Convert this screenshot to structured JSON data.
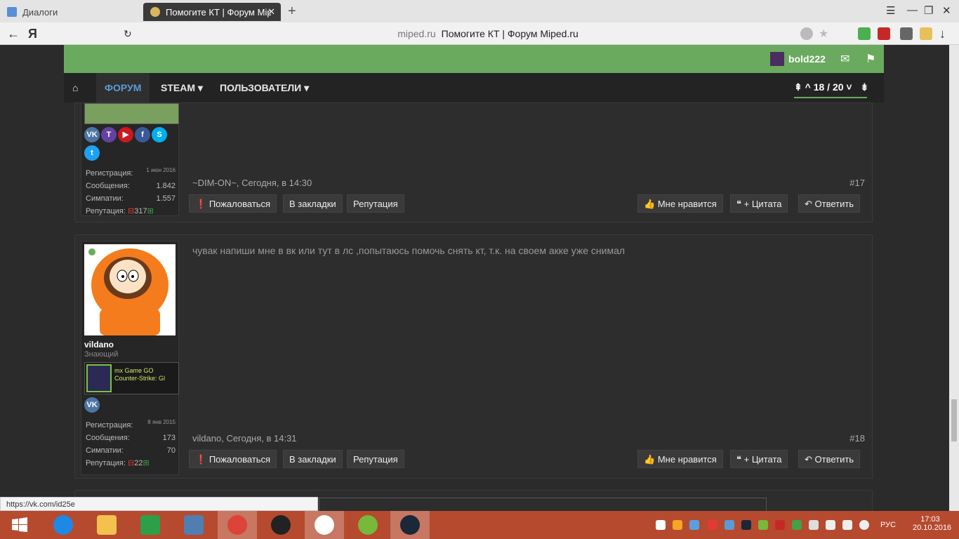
{
  "browser": {
    "tabs": [
      {
        "label": "Диалоги"
      },
      {
        "label": "Помогите КТ | Форум Miped.ru"
      }
    ],
    "address": {
      "domain": "miped.ru",
      "title": "Помогите КТ | Форум Miped.ru"
    },
    "status_url": "https://vk.com/id25e"
  },
  "site": {
    "username": "bold222",
    "nav": {
      "home_icon": "home-icon",
      "forum": "ФОРУМ",
      "steam": "STEAM",
      "users": "ПОЛЬЗОВАТЕЛИ"
    },
    "pager": "18 / 20"
  },
  "posts": [
    {
      "author": "~DIM-ON~",
      "time": "Сегодня, в 14:30",
      "number": "#17",
      "stats": {
        "reg_label": "Регистрация:",
        "reg": "1 июн 2016",
        "msg_label": "Сообщения:",
        "messages": "1.842",
        "likes_label": "Симпатии:",
        "likes": "1.557",
        "rep_label": "Репутация:",
        "reputation": "317"
      },
      "social": [
        {
          "name": "vk",
          "label": "VK",
          "color": "#4c75a3"
        },
        {
          "name": "twitch",
          "label": "T",
          "color": "#6441a5"
        },
        {
          "name": "youtube",
          "label": "▶",
          "color": "#cc181e"
        },
        {
          "name": "facebook",
          "label": "f",
          "color": "#3b5998"
        },
        {
          "name": "skype",
          "label": "S",
          "color": "#00aff0"
        },
        {
          "name": "twitter",
          "label": "t",
          "color": "#1da1f2"
        }
      ]
    },
    {
      "author": "vildano",
      "user_title": "Знающий",
      "message": "чувак напиши мне в вк или тут в лс ,попытаюсь помочь снять кт, т.к. на своем акке уже снимал",
      "time": "Сегодня, в 14:31",
      "number": "#18",
      "stats": {
        "reg_label": "Регистрация:",
        "reg": "8 янв 2015",
        "msg_label": "Сообщения:",
        "messages": "173",
        "likes_label": "Симпатии:",
        "likes": "70",
        "rep_label": "Репутация:",
        "reputation": "22"
      },
      "banner_text": "mx Game GO Counter-Strike: Gl"
    }
  ],
  "buttons": {
    "report": "Пожаловаться",
    "bookmark": "В закладки",
    "rep": "Репутация",
    "like": "Мне нравится",
    "quote": "+ Цитата",
    "reply": "Ответить"
  },
  "taskbar": {
    "lang": "РУС",
    "time": "17:03",
    "date": "20.10.2016"
  },
  "colors": {
    "green": "#6aaa5e",
    "nav_bg": "#232323",
    "accent_blue": "#5c9ad6",
    "taskbar": "#b54a2e"
  }
}
